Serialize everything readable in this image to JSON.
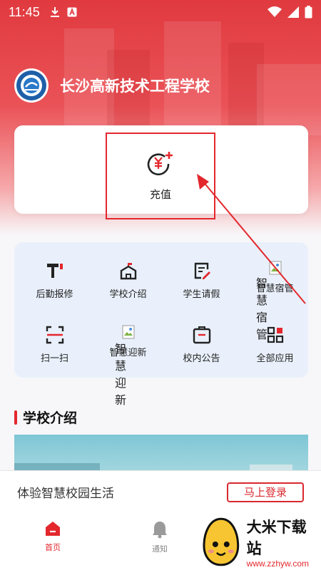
{
  "status_bar": {
    "time": "11:45"
  },
  "header": {
    "school_name": "长沙高新技术工程学校"
  },
  "recharge": {
    "label": "充值"
  },
  "services": [
    {
      "label": "后勤报修",
      "icon": "wrench-icon"
    },
    {
      "label": "学校介绍",
      "icon": "building-icon"
    },
    {
      "label": "学生请假",
      "icon": "edit-doc-icon"
    },
    {
      "label": "智慧宿管",
      "icon": "broken-image-icon",
      "alt": "智慧宿管"
    },
    {
      "label": "扫一扫",
      "icon": "scan-icon"
    },
    {
      "label": "智慧迎新",
      "icon": "broken-image-icon",
      "alt": "智慧迎新"
    },
    {
      "label": "校内公告",
      "icon": "notice-icon"
    },
    {
      "label": "全部应用",
      "icon": "apps-icon"
    }
  ],
  "section": {
    "title": "学校介绍"
  },
  "login_bar": {
    "text": "体验智慧校园生活",
    "button": "马上登录"
  },
  "tabbar": [
    {
      "label": "首页",
      "active": true
    },
    {
      "label": "通知",
      "active": false
    }
  ],
  "watermark": {
    "title": "大米下载站",
    "url": "www.zzhyw.com"
  },
  "colors": {
    "primary": "#e3272d",
    "hero": "#e03a3f",
    "grid_bg": "#e9f0fb"
  }
}
